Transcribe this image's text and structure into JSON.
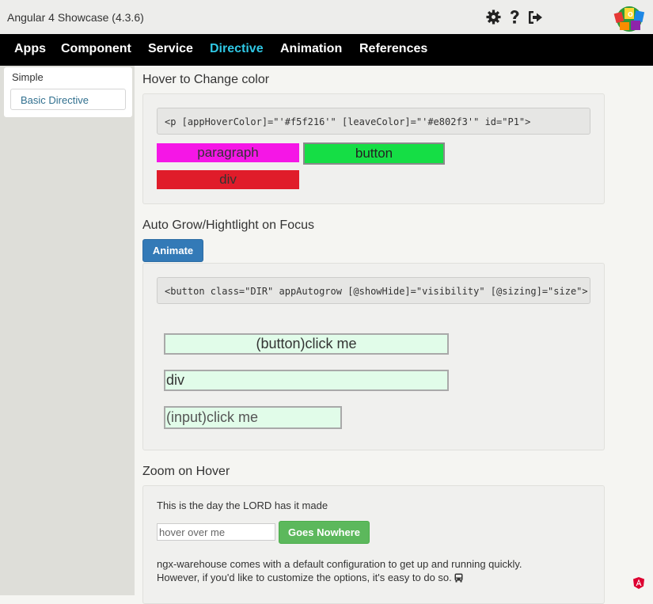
{
  "app": {
    "title": "Angular 4 Showcase (4.3.6)"
  },
  "top_icons": [
    "gear-icon",
    "question-icon",
    "sign-out-icon"
  ],
  "nav": {
    "items": [
      {
        "label": "Apps"
      },
      {
        "label": "Component"
      },
      {
        "label": "Service"
      },
      {
        "label": "Directive",
        "active": true
      },
      {
        "label": "Animation"
      },
      {
        "label": "References"
      }
    ]
  },
  "sidebar": {
    "heading": "Simple",
    "items": [
      {
        "label": "Basic Directive"
      }
    ]
  },
  "hover_section": {
    "title": "Hover to Change color",
    "code": "<p [appHoverColor]=\"'#f5f216'\" [leaveColor]=\"'#e802f3'\" id=\"P1\">",
    "paragraph": "paragraph",
    "button": "button",
    "div": "div"
  },
  "grow_section": {
    "title": "Auto Grow/Hightlight on Focus",
    "animate_label": "Animate",
    "code": "<button class=\"DIR\" appAutogrow [@showHide]=\"visibility\" [@sizing]=\"size\">",
    "button": "(button)click me",
    "div": "div",
    "input_placeholder": "(input)click me"
  },
  "zoom_section": {
    "title": "Zoom on Hover",
    "text": "This is the day the LORD has it made",
    "input_placeholder": "hover over me",
    "button": "Goes Nowhere",
    "line1": "ngx-warehouse comes with a default configuration to get up and running quickly.",
    "line2": "However, if you'd like to customize the options, it's easy to do so. "
  },
  "colors": {
    "accent": "#2fc7e4",
    "primary": "#337ab7",
    "success": "#5cb85c",
    "hover_paragraph": "#f516e6",
    "hover_button": "#15de45",
    "hover_div": "#e01c2a",
    "autogrow_bg": "#e1fce9"
  }
}
